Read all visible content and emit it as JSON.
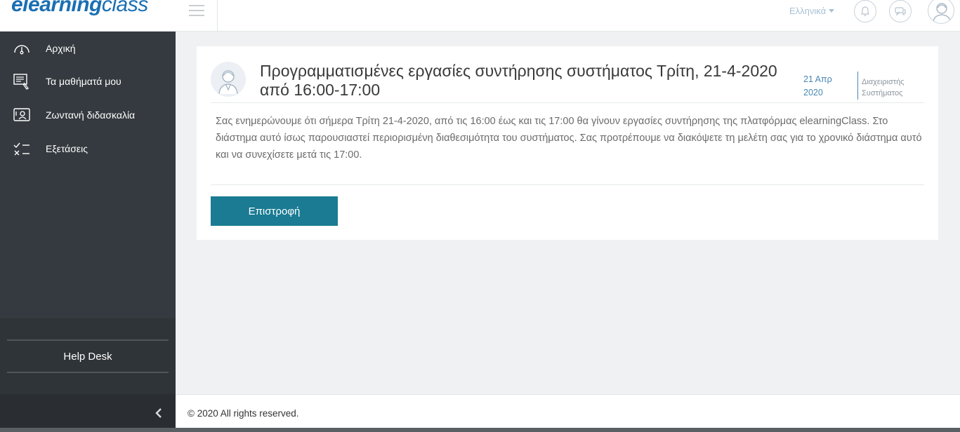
{
  "header": {
    "logo_bold": "elearning",
    "logo_thin": "class",
    "language": "Ελληνικά"
  },
  "sidebar": {
    "items": [
      {
        "label": "Αρχική",
        "icon": "dashboard-gauge-icon"
      },
      {
        "label": "Τα μαθήματά μου",
        "icon": "courses-icon"
      },
      {
        "label": "Ζωντανή διδασκαλία",
        "icon": "live-teaching-icon"
      },
      {
        "label": "Εξετάσεις",
        "icon": "exams-checklist-icon"
      }
    ],
    "help_desk": "Help Desk"
  },
  "post": {
    "title": "Προγραμματισμένες εργασίες συντήρησης συστήματος Τρίτη, 21-4-2020 από 16:00-17:00",
    "date": "21 Απρ 2020",
    "author": "Διαχειριστής Συστήματος",
    "body": "Σας ενημερώνουμε ότι σήμερα Τρίτη 21-4-2020, από τις 16:00 έως και τις 17:00 θα γίνουν εργασίες συντήρησης της πλατφόρμας elearningClass. Στο διάστημα αυτό ίσως παρουσιαστεί περιορισμένη διαθεσιμότητα του συστήματος. Σας προτρέπουμε να διακόψετε τη μελέτη σας για το χρονικό διάστημα αυτό και να συνεχίσετε μετά τις 17:00.",
    "back_label": "Επιστροφή"
  },
  "footer": {
    "copyright": "© 2020 All rights reserved."
  },
  "colors": {
    "brand": "#1a6fb3",
    "sidebar": "#343a3f",
    "button": "#1a7b93",
    "date": "#4a86b4"
  }
}
